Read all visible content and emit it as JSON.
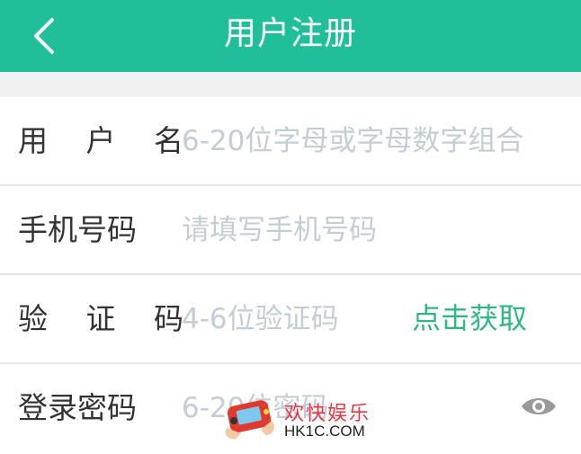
{
  "header": {
    "title": "用户注册",
    "back_icon": "chevron-left-icon",
    "background_color": "#1fbf99"
  },
  "form": {
    "username": {
      "label": "用 户 名",
      "placeholder": "6-20位字母或字母数字组合",
      "value": ""
    },
    "phone": {
      "label": "手机号码",
      "placeholder": "请填写手机号码",
      "value": ""
    },
    "code": {
      "label": "验 证 码",
      "placeholder": "4-6位验证码",
      "value": "",
      "action_label": "点击获取",
      "action_color": "#2fb784"
    },
    "password": {
      "label": "登录密码",
      "placeholder": "6-20位密码",
      "value": "",
      "toggle_icon": "eye-icon"
    }
  },
  "watermark": {
    "title": "欢快娱乐",
    "subtitle": "HK1C.COM"
  }
}
